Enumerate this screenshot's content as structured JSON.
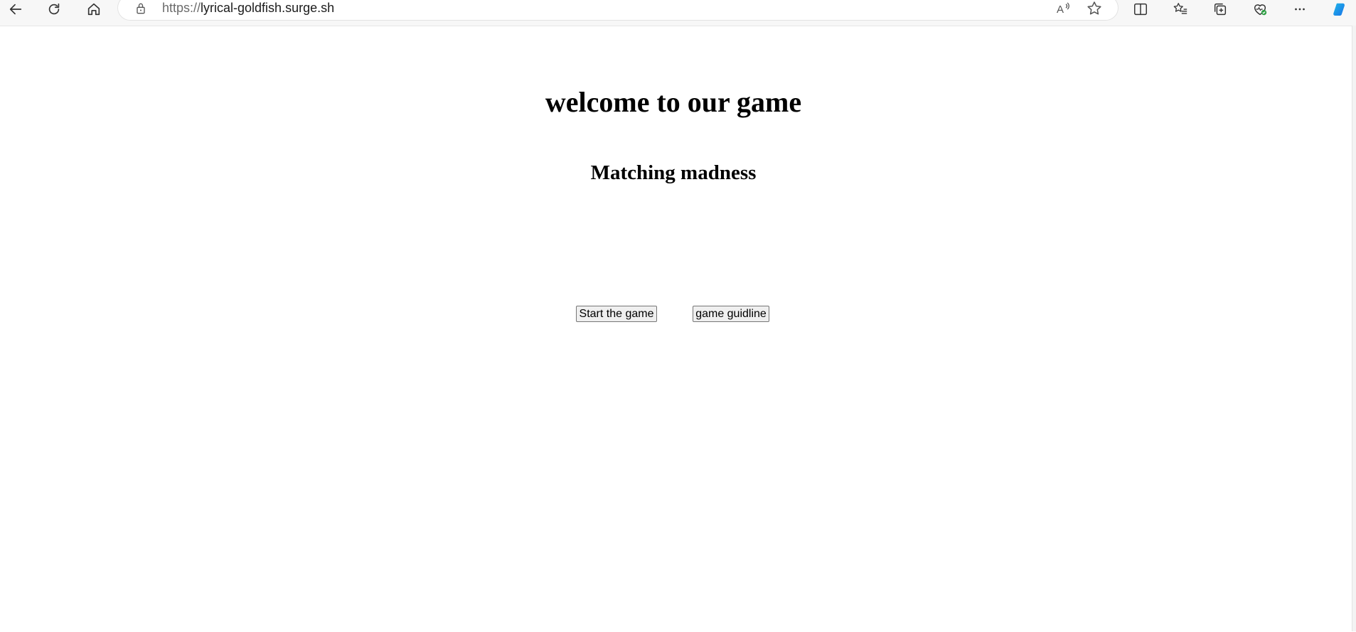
{
  "browser": {
    "url_protocol": "https://",
    "url_host": "lyrical-goldfish.surge.sh",
    "toolbar_icons": [
      "back-icon",
      "refresh-icon",
      "home-icon",
      "lock-icon",
      "read-aloud-icon",
      "favorite-star-icon",
      "split-screen-icon",
      "favorites-icon",
      "collections-icon",
      "browser-essentials-icon",
      "more-icon",
      "copilot-icon"
    ]
  },
  "page": {
    "title": "welcome to our game",
    "subtitle": "Matching madness",
    "start_button": "Start the game",
    "guide_button": "game guidline"
  },
  "colors": {
    "accent_green": "#2e9e44",
    "copilot_blue": "#1a73e8"
  }
}
